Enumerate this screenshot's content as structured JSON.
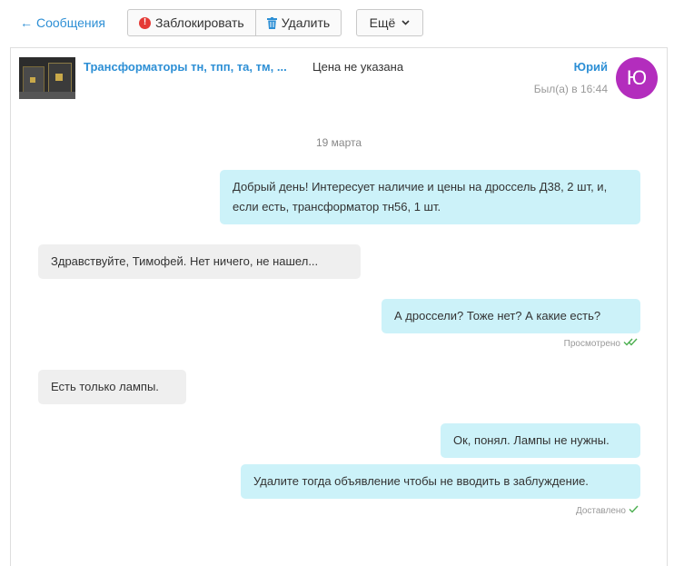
{
  "toolbar": {
    "back_label": "Сообщения",
    "block_label": "Заблокировать",
    "delete_label": "Удалить",
    "more_label": "Ещё"
  },
  "ad": {
    "title": "Трансформаторы тн, тпп, та, тм, ...",
    "price": "Цена не указана"
  },
  "user": {
    "name": "Юрий",
    "last_seen": "Был(а) в 16:44",
    "avatar_letter": "Ю",
    "avatar_color": "#b32dbd"
  },
  "conversation": {
    "date": "19 марта",
    "messages": [
      {
        "direction": "out",
        "text": "Добрый день! Интересует наличие и цены на дроссель Д38, 2 шт, и, если есть, трансформатор тн56, 1 шт."
      },
      {
        "direction": "in",
        "text": "Здравствуйте, Тимофей. Нет ничего, не нашел..."
      },
      {
        "direction": "out",
        "text": "А дроссели? Тоже нет? А какие есть?",
        "status": "Просмотрено"
      },
      {
        "direction": "in",
        "text": "Есть только лампы."
      },
      {
        "direction": "out",
        "text": "Ок, понял. Лампы не нужны."
      },
      {
        "direction": "out",
        "text": "Удалите тогда объявление чтобы не вводить в заблуждение.",
        "status": "Доставлено"
      }
    ]
  },
  "colors": {
    "link": "#2d8fd5",
    "outgoing_bubble": "#ccf2f9",
    "incoming_bubble": "#efefef",
    "check": "#4caf50"
  }
}
